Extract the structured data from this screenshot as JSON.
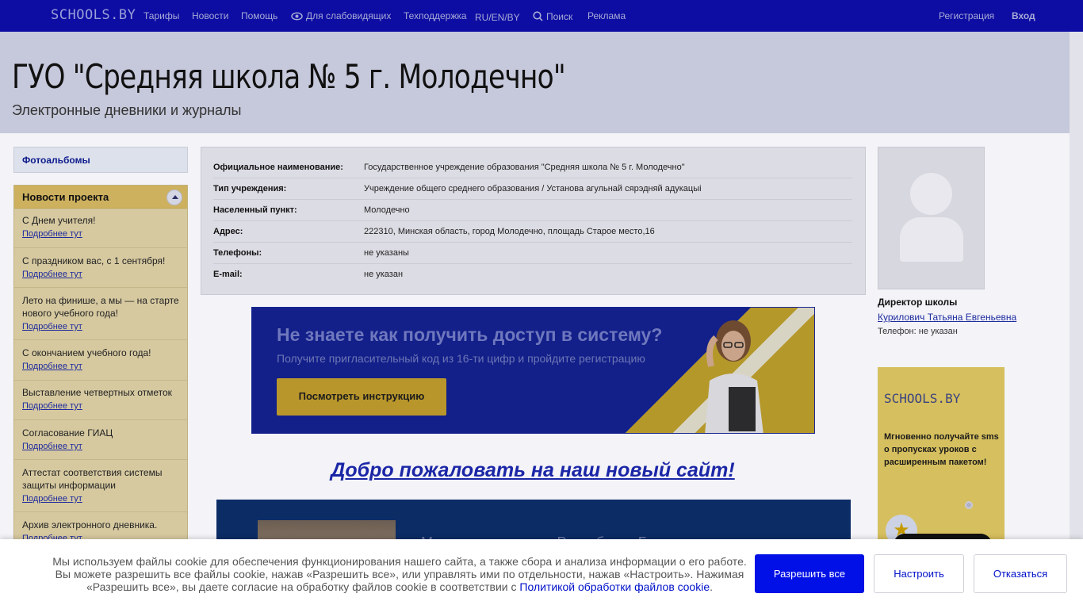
{
  "topnav": {
    "logo": "SCHOOLS.BY",
    "items": [
      {
        "label": "Тарифы"
      },
      {
        "label": "Новости"
      },
      {
        "label": "Помощь"
      },
      {
        "label": "Для слабовидящих"
      },
      {
        "label": "Техподдержка"
      },
      {
        "label": "RU/EN/BY"
      },
      {
        "label": "Поиск"
      },
      {
        "label": "Реклама"
      }
    ],
    "register": "Регистрация",
    "login": "Вход"
  },
  "header": {
    "title": "ГУО \"Средняя школа № 5 г. Молодечно\"",
    "subtitle": "Электронные дневники и журналы"
  },
  "sidebar": {
    "photo_albums": "Фотоальбомы",
    "news_title": "Новости проекта",
    "more_label": "Подробнее тут",
    "news": [
      {
        "title": "С Днем учителя!"
      },
      {
        "title": "С праздником вас, с 1 сентября!"
      },
      {
        "title": "Лето на финише, а мы — на старте нового учебного года!"
      },
      {
        "title": "С окончанием учебного года!"
      },
      {
        "title": "Выставление четвертных отметок"
      },
      {
        "title": "Согласование ГИАЦ"
      },
      {
        "title": "Аттестат соответствия системы защиты информации"
      },
      {
        "title": "Архив электронного дневника."
      }
    ]
  },
  "info": {
    "rows": [
      {
        "label": "Официальное наименование:",
        "value": "Государственное учреждение образования \"Средняя школа № 5 г. Молодечно\""
      },
      {
        "label": "Тип учреждения:",
        "value": "Учреждение общего среднего образования / Установа агульнай сярэдняй адукацыі"
      },
      {
        "label": "Населенный пункт:",
        "value": "Молодечно"
      },
      {
        "label": "Адрес:",
        "value": "222310, Минская область, город Молодечно, площадь Старое место,16"
      },
      {
        "label": "Телефоны:",
        "value": "не указаны"
      },
      {
        "label": "E-mail:",
        "value": "не указан"
      }
    ]
  },
  "banner": {
    "title": "Не знаете как получить доступ в систему?",
    "subtitle": "Получите пригласительный код из 16-ти цифр и пройдите регистрацию",
    "button": "Посмотреть инструкцию"
  },
  "welcome": "Добро пожаловать на наш  новый сайт!",
  "lower": {
    "text": "Молодечно глазами Республики Беларусь"
  },
  "director": {
    "role": "Директор школы",
    "name": "Курилович Татьяна Евгеньевна",
    "phone": "Телефон: не указан"
  },
  "ad": {
    "logo": "SCHOOLS.BY",
    "text": "Мгновенно получайте sms о пропусках уроков с расширенным пакетом!"
  },
  "cookie": {
    "text_before": "Мы используем файлы cookie для обеспечения функционирования нашего сайта, а также сбора и анализа информации о его работе. Вы можете разрешить все файлы cookie, нажав «Разрешить все», или управлять ими по отдельности, нажав «Настроить». Нажимая «Разрешить все», вы даете согласие на обработку файлов cookie в соответствии с ",
    "link": "Политикой обработки файлов cookie",
    "text_after": ".",
    "allow_all": "Разрешить все",
    "configure": "Настроить",
    "decline": "Отказаться"
  },
  "colors": {
    "nav_bg": "#0d0da3",
    "accent_blue": "#0010e6",
    "news_header": "#cdb15f"
  }
}
